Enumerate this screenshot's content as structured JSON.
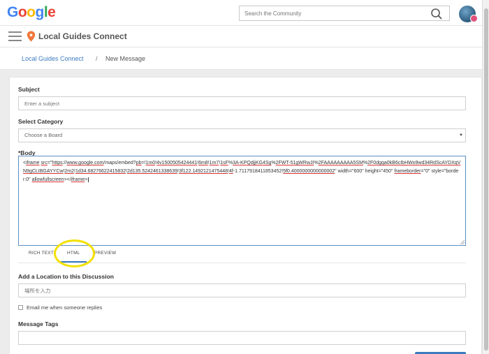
{
  "header": {
    "logo_letters": [
      {
        "ch": "G",
        "color": "#4285F4"
      },
      {
        "ch": "o",
        "color": "#EA4335"
      },
      {
        "ch": "o",
        "color": "#FBBC05"
      },
      {
        "ch": "g",
        "color": "#4285F4"
      },
      {
        "ch": "l",
        "color": "#34A853"
      },
      {
        "ch": "e",
        "color": "#EA4335"
      }
    ],
    "search_placeholder": "Search the Community"
  },
  "subheader": {
    "brand": "Local Guides Connect"
  },
  "breadcrumb": {
    "link": "Local Guides Connect",
    "separator": "/",
    "current": "New Message"
  },
  "form": {
    "subject_label": "Subject",
    "subject_placeholder": "Enter a subject",
    "category_label": "Select Category",
    "category_value": "Choose a Board",
    "body_label": "*Body",
    "body_segments": [
      {
        "t": "<",
        "u": false
      },
      {
        "t": "iframe",
        "u": true
      },
      {
        "t": " ",
        "u": false
      },
      {
        "t": "src",
        "u": true
      },
      {
        "t": "=\"",
        "u": false
      },
      {
        "t": "https",
        "u": true
      },
      {
        "t": "://",
        "u": false
      },
      {
        "t": "www.google.com",
        "u": true
      },
      {
        "t": "/maps/embed?",
        "u": false
      },
      {
        "t": "pb",
        "u": true
      },
      {
        "t": "=!",
        "u": false
      },
      {
        "t": "1m0",
        "u": true
      },
      {
        "t": "!",
        "u": false
      },
      {
        "t": "4v1500505424441",
        "u": true
      },
      {
        "t": "!",
        "u": false
      },
      {
        "t": "6m8",
        "u": true
      },
      {
        "t": "!",
        "u": false
      },
      {
        "t": "1m7",
        "u": true
      },
      {
        "t": "!",
        "u": false
      },
      {
        "t": "1sF",
        "u": true
      },
      {
        "t": "%",
        "u": false
      },
      {
        "t": "3A-KPQdjjKG4Sg",
        "u": true
      },
      {
        "t": "%",
        "u": false
      },
      {
        "t": "2FWT-51gWRwJI",
        "u": true
      },
      {
        "t": "%",
        "u": false
      },
      {
        "t": "2FAAAAAAAAA5SM",
        "u": true
      },
      {
        "t": "%",
        "u": false
      },
      {
        "t": "2F0dgqa0kB6cIbHWo9wd34RdScAYDXqVN9gCLIBGAYYCw",
        "u": true
      },
      {
        "t": "!",
        "u": false
      },
      {
        "t": "2m2",
        "u": true
      },
      {
        "t": "!",
        "u": false
      },
      {
        "t": "1d34.68276622415832",
        "u": true
      },
      {
        "t": "!",
        "u": false
      },
      {
        "t": "2d135.5242461338639",
        "u": true
      },
      {
        "t": "!",
        "u": false
      },
      {
        "t": "3f122.1492121475448",
        "u": true
      },
      {
        "t": "!",
        "u": false
      },
      {
        "t": "4f",
        "u": true
      },
      {
        "t": "-1.7117918411853452!",
        "u": false
      },
      {
        "t": "5f0.4000000000000002",
        "u": true
      },
      {
        "t": "\" width=\"600\" height=\"450\" ",
        "u": false
      },
      {
        "t": "frameborder",
        "u": true
      },
      {
        "t": "=\"0\" style=\"border:0\" ",
        "u": false
      },
      {
        "t": "allowfullscreen",
        "u": true
      },
      {
        "t": "></",
        "u": false
      },
      {
        "t": "iframe",
        "u": true
      },
      {
        "t": ">",
        "u": false
      }
    ],
    "tabs": [
      "RICH TEXT",
      "HTML",
      "PREVIEW"
    ],
    "active_tab": "HTML",
    "location_label": "Add a Location to this Discussion",
    "location_placeholder": "場所を入力",
    "email_label": "Email me when someone replies",
    "tags_label": "Message Tags"
  },
  "colors": {
    "accent": "#3b7bbf",
    "highlight_ring": "#f2e000"
  }
}
